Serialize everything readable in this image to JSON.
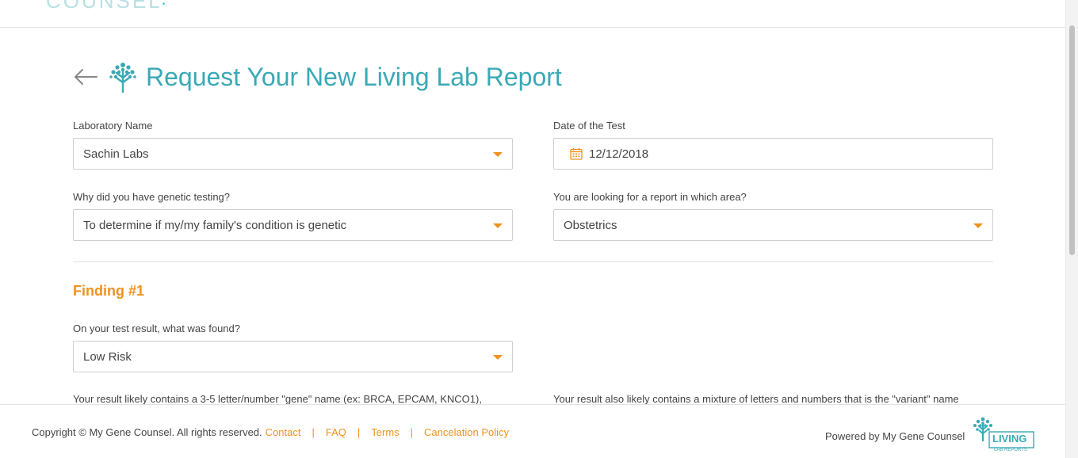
{
  "header": {
    "logo_text": "COUNSEL",
    "logo_dot": "•"
  },
  "page": {
    "title": "Request Your New Living Lab Report"
  },
  "form": {
    "lab": {
      "label": "Laboratory Name",
      "value": "Sachin Labs"
    },
    "date": {
      "label": "Date of the Test",
      "value": "12/12/2018"
    },
    "why": {
      "label": "Why did you have genetic testing?",
      "value": "To determine if my/my family's condition is genetic"
    },
    "area": {
      "label": "You are looking for a report in which area?",
      "value": "Obstetrics"
    }
  },
  "finding": {
    "title": "Finding #1",
    "found": {
      "label": "On your test result, what was found?",
      "value": "Low Risk"
    },
    "help_left": "Your result likely contains a 3-5 letter/number \"gene\" name (ex: BRCA, EPCAM, KNCO1),",
    "help_right": "Your result also likely contains a mixture of letters and numbers that is the \"variant\" name"
  },
  "footer": {
    "copyright": "Copyright © My Gene Counsel. All rights reserved.",
    "links": [
      "Contact",
      "FAQ",
      "Terms",
      "Cancelation Policy"
    ],
    "separator": "|",
    "powered_by": "Powered by My Gene Counsel",
    "logo_line1": "LIVING",
    "logo_line2": "LAB REPORTS"
  },
  "colors": {
    "accent": "#f0911e",
    "brand_teal": "#3aa9b6",
    "border": "#cfcfcf"
  },
  "icons": [
    "back-arrow-icon",
    "tree-icon",
    "calendar-icon",
    "chevron-down-icon"
  ]
}
